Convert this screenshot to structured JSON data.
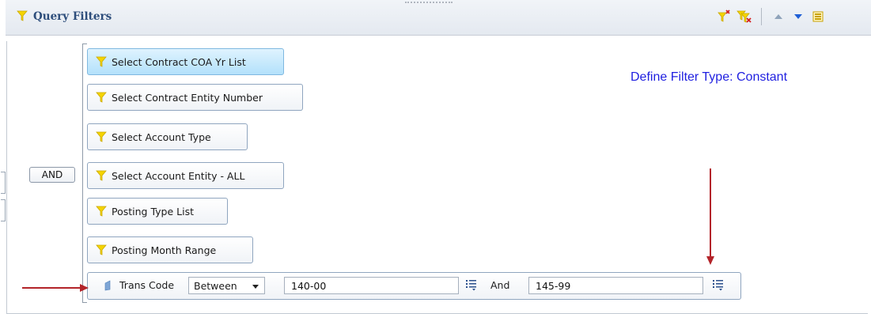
{
  "header": {
    "title": "Query Filters"
  },
  "group": {
    "operator_label": "AND"
  },
  "filters": [
    {
      "label": "Select Contract COA Yr List",
      "selected": true
    },
    {
      "label": "Select Contract Entity Number",
      "selected": false
    },
    {
      "label": "Select Account Type",
      "selected": false
    },
    {
      "label": "Select Account Entity - ALL",
      "selected": false
    },
    {
      "label": "Posting Type List",
      "selected": false
    },
    {
      "label": "Posting Month Range",
      "selected": false
    }
  ],
  "trans_row": {
    "label": "Trans Code",
    "operator": "Between",
    "value_from": "140-00",
    "connector": "And",
    "value_to": "145-99"
  },
  "annotation": {
    "text": "Define Filter Type: Constant"
  },
  "colors": {
    "filter_icon": "#f5d400",
    "arrow": "#b3242a",
    "annotation_text": "#1f1fe0",
    "header_title": "#2d4d7b"
  },
  "icons": [
    "filter-icon",
    "add-filter-icon",
    "remove-filters-icon",
    "move-up-icon",
    "move-down-icon",
    "panel-options-icon",
    "list-options-icon"
  ]
}
